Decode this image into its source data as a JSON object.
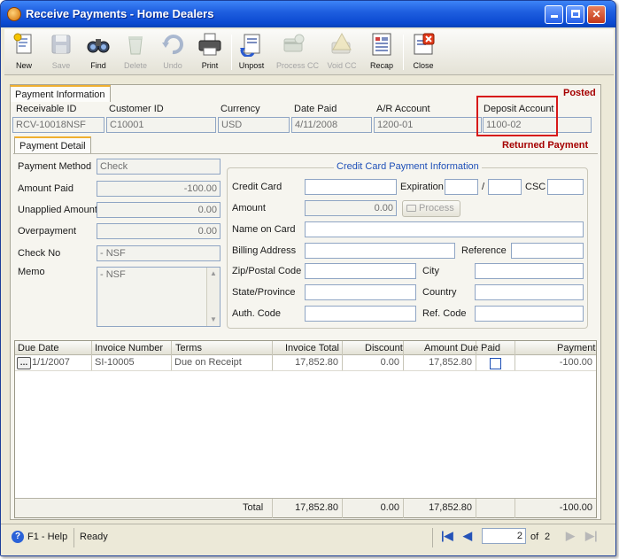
{
  "window": {
    "title": "Receive Payments - Home Dealers"
  },
  "toolbar": {
    "new": "New",
    "save": "Save",
    "find": "Find",
    "delete": "Delete",
    "undo": "Undo",
    "print": "Print",
    "unpost": "Unpost",
    "process_cc": "Process CC",
    "void_cc": "Void CC",
    "recap": "Recap",
    "close": "Close"
  },
  "payment_info": {
    "tab_label": "Payment Information",
    "posted_status": "Posted",
    "receivable_id_label": "Receivable ID",
    "receivable_id": "RCV-10018NSF",
    "customer_id_label": "Customer ID",
    "customer_id": "C10001",
    "currency_label": "Currency",
    "currency": "USD",
    "date_paid_label": "Date Paid",
    "date_paid": "4/11/2008",
    "ar_account_label": "A/R Account",
    "ar_account": "1200-01",
    "deposit_account_label": "Deposit Account",
    "deposit_account": "1100-02"
  },
  "payment_detail": {
    "tab_label": "Payment Detail",
    "returned_status": "Returned Payment",
    "payment_method_label": "Payment Method",
    "payment_method": "Check",
    "amount_paid_label": "Amount Paid",
    "amount_paid": "-100.00",
    "unapplied_label": "Unapplied Amount",
    "unapplied": "0.00",
    "overpayment_label": "Overpayment",
    "overpayment": "0.00",
    "check_no_label": "Check No",
    "check_no": "- NSF",
    "memo_label": "Memo",
    "memo": "- NSF"
  },
  "credit_card": {
    "title": "Credit Card Payment Information",
    "credit_card_label": "Credit Card",
    "credit_card": "",
    "expiration_label": "Expiration",
    "slash": "/",
    "csc_label": "CSC",
    "amount_label": "Amount",
    "amount": "0.00",
    "process_label": "Process",
    "name_label": "Name on Card",
    "billing_label": "Billing Address",
    "reference_label": "Reference",
    "zip_label": "Zip/Postal Code",
    "city_label": "City",
    "state_label": "State/Province",
    "country_label": "Country",
    "auth_label": "Auth. Code",
    "ref_code_label": "Ref. Code"
  },
  "grid": {
    "headers": [
      "Due Date",
      "Invoice Number",
      "Terms",
      "Invoice Total",
      "Discount",
      "Amount Due",
      "Paid",
      "Payment"
    ],
    "rows": [
      {
        "due_date": "1/1/2007",
        "invoice": "SI-10005",
        "terms": "Due on Receipt",
        "total": "17,852.80",
        "discount": "0.00",
        "amount_due": "17,852.80",
        "paid": false,
        "payment": "-100.00"
      }
    ],
    "footer": {
      "label": "Total",
      "total": "17,852.80",
      "discount": "0.00",
      "amount_due": "17,852.80",
      "payment": "-100.00"
    }
  },
  "statusbar": {
    "help": "F1 - Help",
    "status": "Ready",
    "page": "2",
    "of": "of",
    "page_count": "2"
  }
}
